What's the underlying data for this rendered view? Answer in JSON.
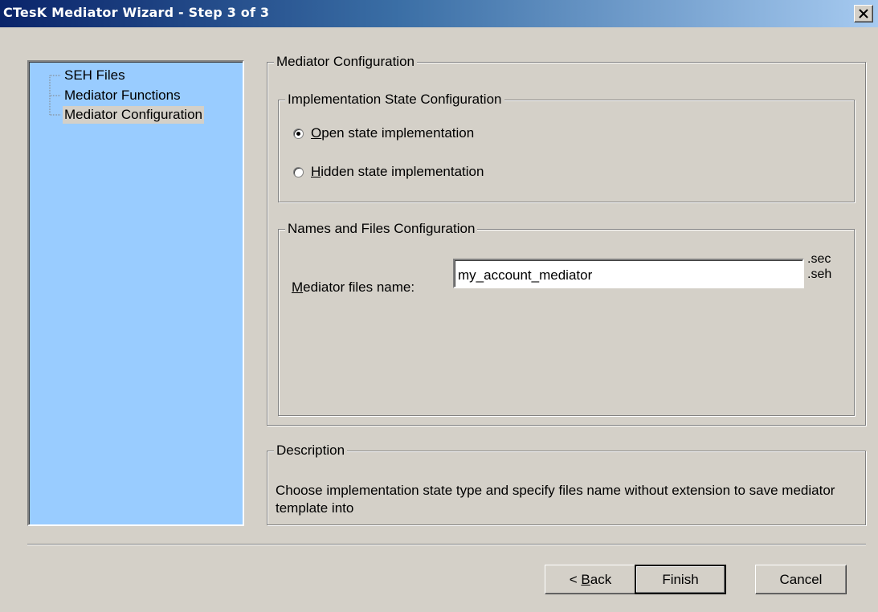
{
  "window": {
    "title": "CTesK Mediator Wizard - Step 3 of 3"
  },
  "tree": {
    "items": [
      {
        "label": "SEH Files"
      },
      {
        "label": "Mediator Functions"
      },
      {
        "label": "Mediator Configuration",
        "selected": true
      }
    ],
    "background": "#99ccff"
  },
  "mediator_config": {
    "legend": "Mediator Configuration",
    "impl_state": {
      "legend": "Implementation State Configuration",
      "open": {
        "accel": "O",
        "rest": "pen state implementation",
        "checked": true
      },
      "hidden": {
        "accel": "H",
        "rest": "idden state implementation",
        "checked": false
      }
    },
    "names_files": {
      "legend": "Names and Files Configuration",
      "label_accel": "M",
      "label_rest": "ediator files name:",
      "value": "my_account_mediator",
      "ext_sec": ".sec",
      "ext_seh": ".seh"
    }
  },
  "description": {
    "legend": "Description",
    "text": "Choose implementation state type and specify files name without extension to save mediator template into"
  },
  "buttons": {
    "back_prefix": "< ",
    "back_accel": "B",
    "back_rest": "ack",
    "finish": "Finish",
    "cancel": "Cancel"
  }
}
